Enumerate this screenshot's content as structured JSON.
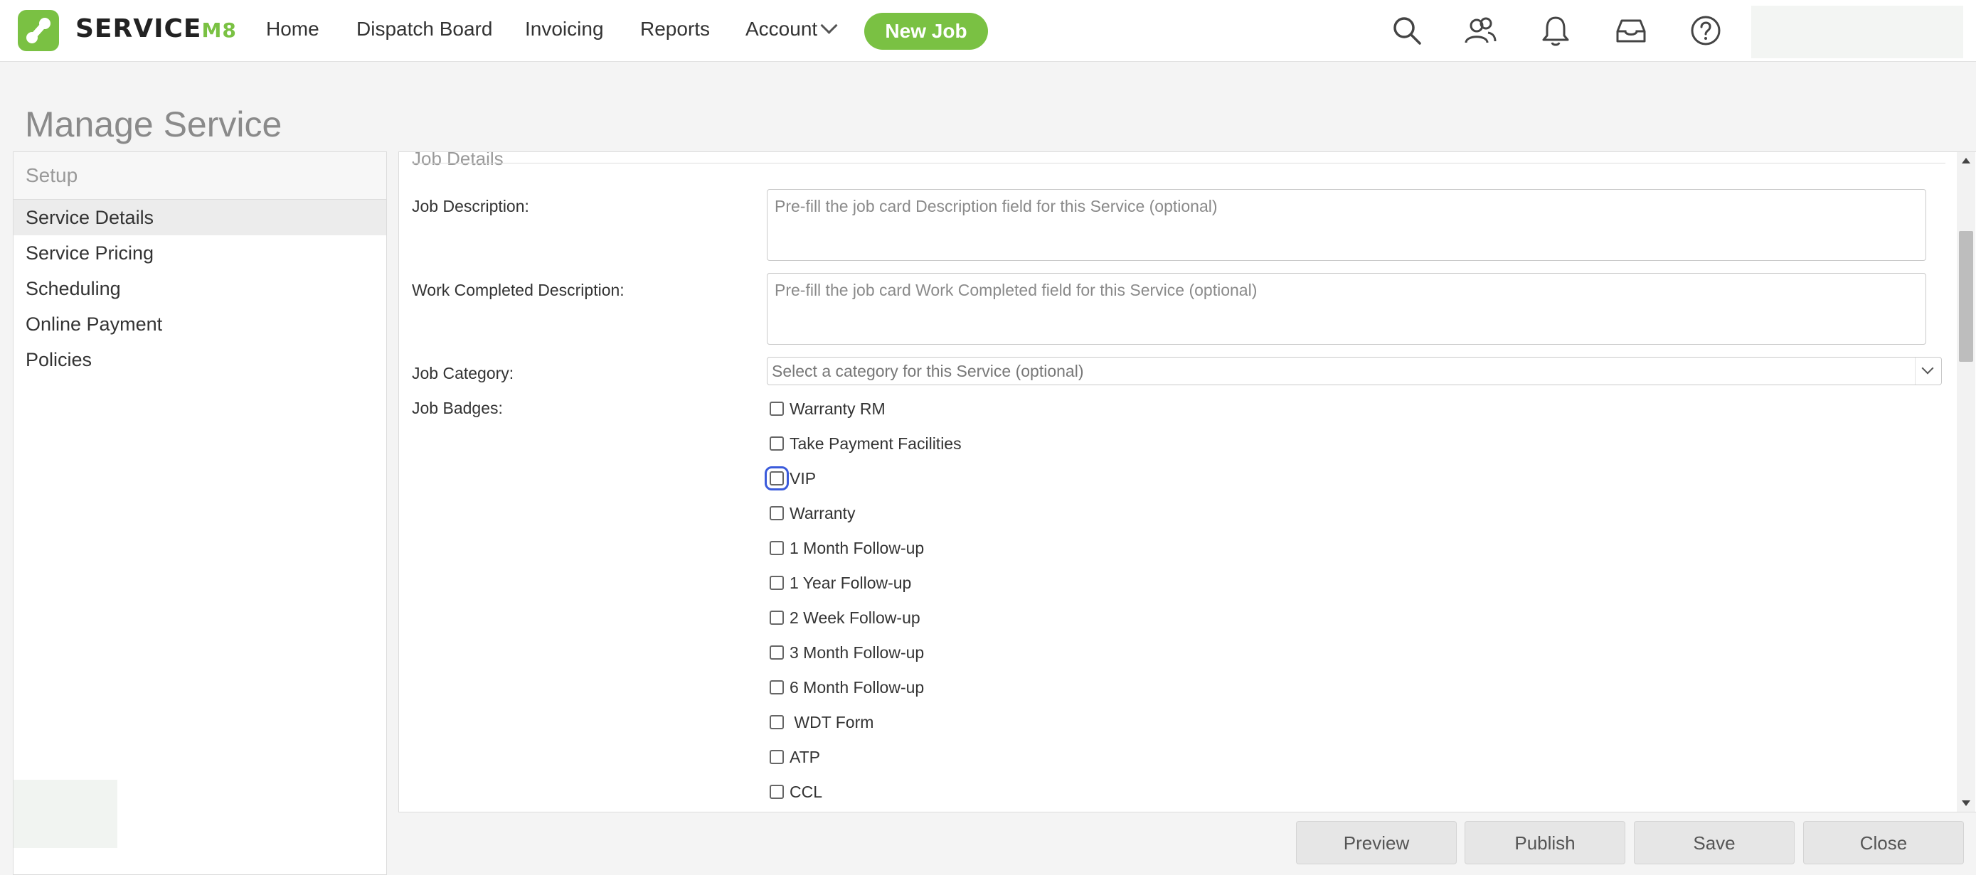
{
  "nav": {
    "brand": "SERVICE",
    "brand_suffix": "M8",
    "items": [
      {
        "label": "Home"
      },
      {
        "label": "Dispatch Board"
      },
      {
        "label": "Invoicing"
      },
      {
        "label": "Reports"
      },
      {
        "label": "Account"
      }
    ],
    "new_job_label": "New Job",
    "icons": [
      "search-icon",
      "people-icon",
      "bell-icon",
      "inbox-icon",
      "help-icon"
    ],
    "accent_color": "#7ac143"
  },
  "page": {
    "title": "Manage Service"
  },
  "sidebar": {
    "header": "Setup",
    "items": [
      {
        "label": "Service Details",
        "active": true
      },
      {
        "label": "Service Pricing"
      },
      {
        "label": "Scheduling"
      },
      {
        "label": "Online Payment"
      },
      {
        "label": "Policies"
      }
    ]
  },
  "form": {
    "section_title": "Job Details",
    "job_description": {
      "label": "Job Description:",
      "placeholder": "Pre-fill the job card Description field for this Service (optional)",
      "value": ""
    },
    "work_completed": {
      "label": "Work Completed Description:",
      "placeholder": "Pre-fill the job card Work Completed field for this Service (optional)",
      "value": ""
    },
    "job_category": {
      "label": "Job Category:",
      "selected": "Select a category for this Service (optional)"
    },
    "job_badges": {
      "label": "Job Badges:",
      "options": [
        {
          "label": "Warranty RM",
          "checked": false
        },
        {
          "label": "Take Payment Facilities",
          "checked": false
        },
        {
          "label": "VIP",
          "checked": false,
          "focused": true
        },
        {
          "label": "Warranty",
          "checked": false
        },
        {
          "label": "1 Month Follow-up",
          "checked": false
        },
        {
          "label": "1 Year Follow-up",
          "checked": false
        },
        {
          "label": "2 Week Follow-up",
          "checked": false
        },
        {
          "label": "3 Month Follow-up",
          "checked": false
        },
        {
          "label": "6 Month Follow-up",
          "checked": false
        },
        {
          "label": " WDT Form",
          "checked": false
        },
        {
          "label": "ATP",
          "checked": false
        },
        {
          "label": "CCL",
          "checked": false
        }
      ]
    }
  },
  "actions": {
    "preview": "Preview",
    "publish": "Publish",
    "save": "Save",
    "close": "Close"
  }
}
